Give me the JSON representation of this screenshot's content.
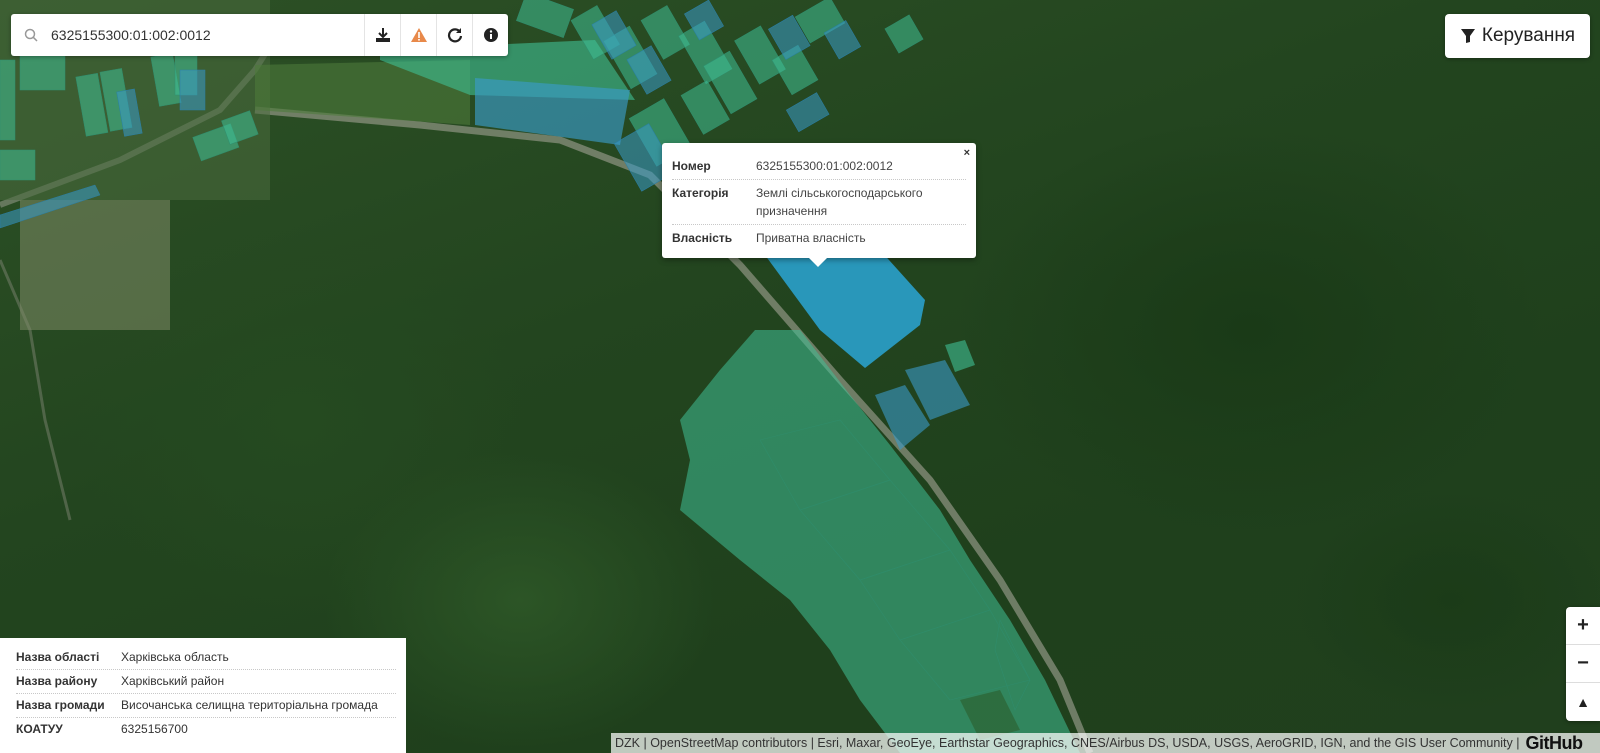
{
  "search": {
    "value": "6325155300:01:002:0012"
  },
  "toolbar": {
    "download_icon": "download-icon",
    "warning_icon": "warning-icon",
    "refresh_icon": "refresh-icon",
    "info_icon": "info-icon"
  },
  "control": {
    "label": "Керування",
    "icon": "filter-icon"
  },
  "popup": {
    "close": "×",
    "rows": [
      {
        "label": "Номер",
        "value": "6325155300:01:002:0012"
      },
      {
        "label": "Категорія",
        "value": "Землі сільськогосподарського призначення"
      },
      {
        "label": "Власність",
        "value": "Приватна власність"
      }
    ]
  },
  "info": {
    "rows": [
      {
        "label": "Назва області",
        "value": "Харківська область"
      },
      {
        "label": "Назва району",
        "value": "Харківський район"
      },
      {
        "label": "Назва громади",
        "value": "Височанська селищна територіальна громада"
      },
      {
        "label": "КОАТУУ",
        "value": "6325156700"
      }
    ]
  },
  "zoom": {
    "in": "+",
    "out": "−",
    "reset": "▲"
  },
  "attribution": {
    "text": "DZK | OpenStreetMap contributors | Esri, Maxar, GeoEye, Earthstar Geographics, CNES/Airbus DS, USDA, USGS, AeroGRID, IGN, and the GIS User Community |",
    "github": "GitHub"
  },
  "colors": {
    "parcel_green": "#3fbf95",
    "parcel_blue": "#3a9bc8",
    "selected_parcel": "#2aa6d6"
  }
}
